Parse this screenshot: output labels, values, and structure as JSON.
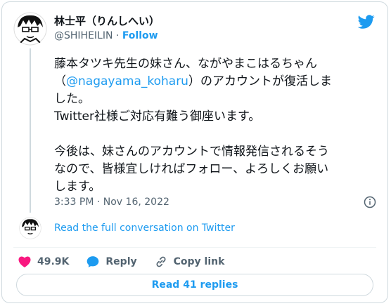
{
  "author": {
    "display_name": "林士平（りんしへい）",
    "handle": "@SHIHEILIN",
    "separator": " · ",
    "follow_label": "Follow"
  },
  "tweet": {
    "line1": "藤本タツキ先生の妹さん、ながやまこはるちゃん",
    "line2_open": "（",
    "mention": "@nagayama_koharu",
    "line2_close": "）のアカウントが復活しま",
    "line3": "した。",
    "line4": "Twitter社様ご対応有難う御座います。",
    "line5": "今後は、妹さんのアカウントで情報発信されるそう",
    "line6": "なので、皆様宜しければフォロー、よろしくお願い",
    "line7": "します。",
    "timestamp": "3:33 PM · Nov 16, 2022"
  },
  "conversation": {
    "read_full_label": "Read the full conversation on Twitter"
  },
  "actions": {
    "likes_count": "49.9K",
    "reply_label": "Reply",
    "copy_link_label": "Copy link",
    "read_replies_label": "Read 41 replies"
  },
  "colors": {
    "accent": "#1d9bf0",
    "like": "#f91880",
    "muted": "#536471",
    "border": "#cfd9de"
  },
  "icons": [
    "twitter-bird-icon",
    "info-icon",
    "heart-icon",
    "reply-bubble-icon",
    "link-icon"
  ]
}
